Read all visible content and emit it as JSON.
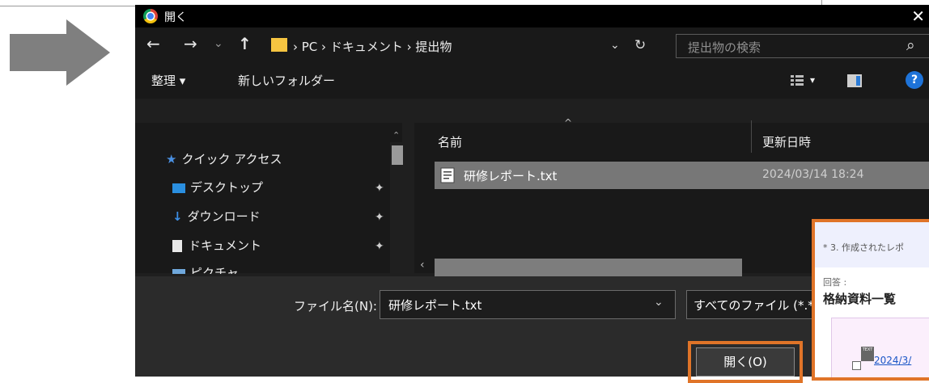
{
  "dialog": {
    "title": "開く",
    "close_symbol": "✕",
    "nav": {
      "back_symbol": "←",
      "forward_symbol": "→",
      "recent_symbol": "⌄",
      "up_symbol": "↑",
      "breadcrumb": "› PC › ドキュメント › 提出物",
      "dropdown_symbol": "⌄",
      "refresh_symbol": "↻",
      "search_placeholder": "提出物の検索",
      "search_icon": "⌕"
    },
    "toolbar": {
      "organize": "整理 ▾",
      "new_folder": "新しいフォルダー",
      "view_symbol": "▾",
      "help_symbol": "?"
    },
    "sidebar": {
      "items": [
        {
          "label": "クイック アクセス",
          "icon": "star-icon"
        },
        {
          "label": "デスクトップ",
          "icon": "desktop-icon"
        },
        {
          "label": "ダウンロード",
          "icon": "download-icon"
        },
        {
          "label": "ドキュメント",
          "icon": "document-icon"
        },
        {
          "label": "ピクチャ",
          "icon": "picture-icon"
        }
      ],
      "pin_symbol": "📌"
    },
    "columns": {
      "name": "名前",
      "modified": "更新日時"
    },
    "files": [
      {
        "name": "研修レポート.txt",
        "modified": "2024/03/14 18:24"
      }
    ],
    "footer": {
      "filename_label": "ファイル名(N):",
      "filename_value": "研修レポート.txt",
      "filetype_value": "すべてのファイル (*.*)",
      "open_button": "開く(O)"
    }
  },
  "overlay": {
    "question": "* 3. 作成されたレポ",
    "answer_label": "回答 :",
    "answer_title": "格納資料一覧",
    "attachment_date": "2024/3/",
    "file_icon_text": "TEXT"
  },
  "colors": {
    "accent_orange": "#e07428",
    "link_blue": "#1a56c7"
  }
}
